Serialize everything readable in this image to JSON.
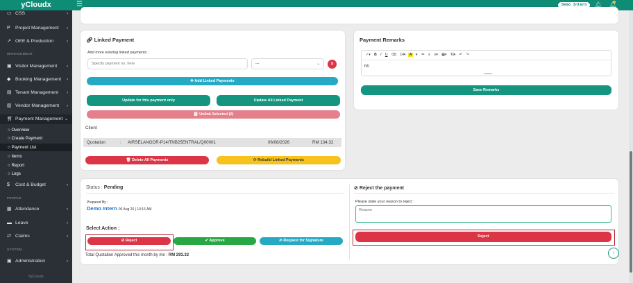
{
  "topbar": {
    "brand": "yCloudx",
    "menu_icon": "hamburger-icon",
    "user": "Demo Intern"
  },
  "sidebar": {
    "items_top": [
      {
        "label": "CSS",
        "icon": "monitor-icon"
      },
      {
        "label": "Project Management",
        "icon": "p-icon"
      },
      {
        "label": "OEE & Production",
        "icon": "chart-icon"
      }
    ],
    "section_management": "MANAGEMENT",
    "items_mgmt": [
      {
        "label": "Visitor Management",
        "icon": "id-card-icon"
      },
      {
        "label": "Booking Management",
        "icon": "tag-icon"
      },
      {
        "label": "Tenant Management",
        "icon": "building-icon"
      },
      {
        "label": "Vendor Management",
        "icon": "vendor-icon"
      },
      {
        "label": "Payment Management",
        "icon": "cart-icon"
      }
    ],
    "payment_sub": [
      "Overview",
      "Create Payment",
      "Payment List",
      "Items",
      "Report",
      "Logs"
    ],
    "cost": "Cost & Budget",
    "section_people": "PEOPLE",
    "items_people": [
      {
        "label": "Attendance",
        "icon": "clipboard-icon"
      },
      {
        "label": "Leave",
        "icon": "bed-icon"
      },
      {
        "label": "Claims",
        "icon": "exchange-icon"
      }
    ],
    "section_system": "SYSTEM",
    "admin": "Administration",
    "footer": "©yCloudx"
  },
  "linked_payment": {
    "title": "Linked Payment",
    "add_label": "Add more existing linked payments :",
    "input_placeholder": "Specify payment no. here",
    "select_value": "---",
    "add_btn": "Add Linked Payments",
    "update_this": "Update for this payment only",
    "update_all": "Update All Linked Payment",
    "unlink": "Unlink Selected (0)",
    "client_label": "Client",
    "row": {
      "type": "Quotation",
      "sep": ":",
      "ref": "AIRSELANGOR-P14/TNB25ENTRAL/Q00001",
      "date": "06/08/2026",
      "amount": "RM 134.32"
    },
    "delete_all": "Delete All Payments",
    "rebuild": "Rebuild Linked Payments"
  },
  "remarks": {
    "title": "Payment Remarks",
    "toolbar": [
      "✓▾",
      "B",
      "I",
      "U",
      "⌫",
      "14▾",
      "A",
      "▾",
      "≔",
      "≡",
      "≡▾",
      "▦▾",
      "Tℹ▾",
      "↶",
      "↷"
    ],
    "content": "hh",
    "save": "Save Remarks"
  },
  "status": {
    "label": "Status :",
    "value": "Pending",
    "prepared_by": "Prepared By :",
    "preparer": "Demo Intern",
    "prepared_date": "06 Aug 26 | 10:16 AM",
    "select_action": "Select Action :",
    "reject": "Reject",
    "approve": "Approve",
    "request_sig": "Request for Signature",
    "total_label": "Total Quotation Approved this month by me :",
    "total_value": "RM 293.32"
  },
  "reject_panel": {
    "title": "Reject the payment",
    "instruction": "Please state your reason to reject :",
    "placeholder": "Reason",
    "button": "Reject"
  },
  "colors": {
    "brand": "#0e8c76",
    "sidebar": "#2b3036",
    "teal": "#13957f",
    "danger": "#dc3545"
  }
}
